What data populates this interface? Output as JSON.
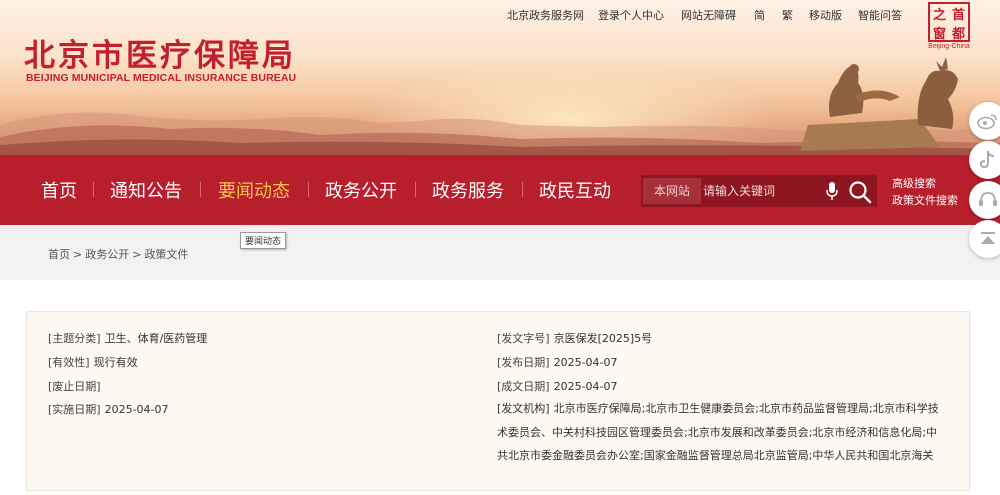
{
  "site": {
    "name_cn": "北京市医疗保障局",
    "name_en": "BEIJING MUNICIPAL MEDICAL INSURANCE BUREAU"
  },
  "top_links": [
    "北京政务服务网",
    "登录个人中心",
    "网站无障碍",
    "简",
    "繁",
    "移动版",
    "智能问答"
  ],
  "capital_logo": {
    "chars": [
      "首",
      "都",
      "之",
      "窗"
    ],
    "en": "Beijing-China"
  },
  "nav": {
    "items": [
      {
        "label": "首页",
        "active": false
      },
      {
        "label": "通知公告",
        "active": false
      },
      {
        "label": "要闻动态",
        "active": true
      },
      {
        "label": "政务公开",
        "active": false
      },
      {
        "label": "政务服务",
        "active": false
      },
      {
        "label": "政民互动",
        "active": false
      }
    ],
    "search_scope": "本网站",
    "search_placeholder": "请输入关键词",
    "advanced_search": "高级搜索",
    "policy_search": "政策文件搜索",
    "tooltip": "要闻动态"
  },
  "breadcrumb": [
    "首页",
    "政务公开",
    "政策文件"
  ],
  "doc_info": {
    "topic": {
      "key": "[主题分类]",
      "value": "卫生、体育/医药管理"
    },
    "validity": {
      "key": "[有效性]",
      "value": "现行有效"
    },
    "repeal_date": {
      "key": "[废止日期]",
      "value": ""
    },
    "effective_date": {
      "key": "[实施日期]",
      "value": "2025-04-07"
    },
    "doc_number": {
      "key": "[发文字号]",
      "value": "京医保发[2025]5号"
    },
    "publish_date": {
      "key": "[发布日期]",
      "value": "2025-04-07"
    },
    "written_date": {
      "key": "[成文日期]",
      "value": "2025-04-07"
    },
    "issuer": {
      "key": "[发文机构]",
      "value": "北京市医疗保障局;北京市卫生健康委员会;北京市药品监督管理局;北京市科学技术委员会、中关村科技园区管理委员会;北京市发展和改革委员会;北京市经济和信息化局;中共北京市委金融委员会办公室;国家金融监督管理总局北京监管局;中华人民共和国北京海关"
    }
  },
  "colors": {
    "brand_red": "#b81f2c",
    "active_nav": "#f5c44a",
    "panel_bg": "#fdf8f1"
  },
  "side_icons": [
    "weibo-icon",
    "douyin-icon",
    "support-icon",
    "back-to-top-icon"
  ]
}
